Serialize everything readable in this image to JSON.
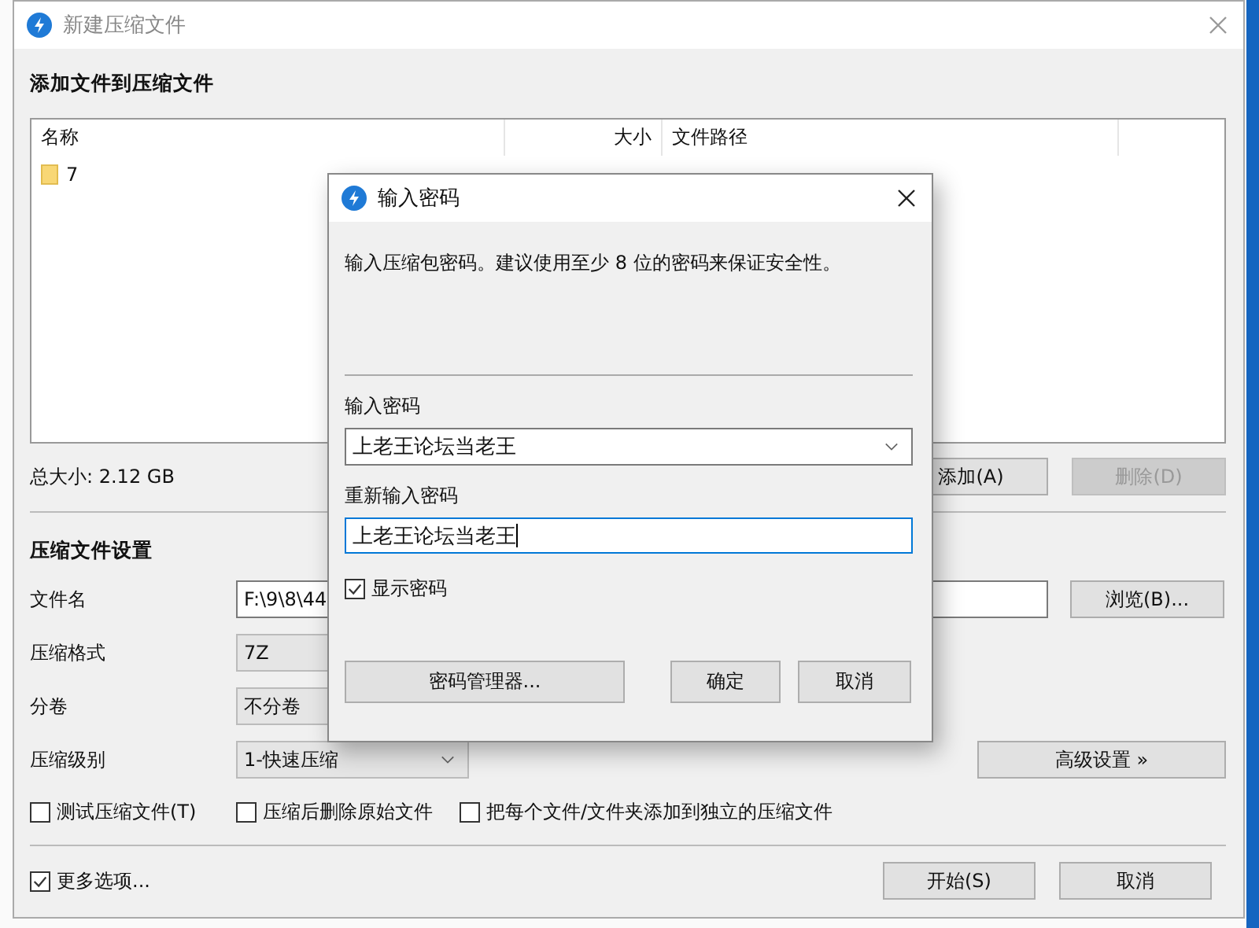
{
  "main_window": {
    "title": "新建压缩文件",
    "section_title": "添加文件到压缩文件",
    "file_list": {
      "columns": [
        "名称",
        "大小",
        "文件路径"
      ],
      "rows": [
        {
          "name": "7"
        }
      ]
    },
    "total_size": "总大小: 2.12 GB",
    "list_buttons": [
      {
        "label": "添加(A)",
        "disabled": false
      },
      {
        "label": "删除(D)",
        "disabled": true
      }
    ],
    "settings_title": "压缩文件设置",
    "settings": [
      {
        "kind": "text",
        "label": "文件名",
        "value": "F:\\9\\8\\44"
      },
      {
        "kind": "select",
        "label": "压缩格式",
        "value": "7Z"
      },
      {
        "kind": "select",
        "label": "分卷",
        "value": "不分卷"
      },
      {
        "kind": "select",
        "label": "压缩级别",
        "value": "1-快速压缩"
      }
    ],
    "browse_button": "浏览(B)...",
    "advanced_button": "高级设置 »",
    "options": [
      {
        "label": "测试压缩文件(T)",
        "checked": false
      },
      {
        "label": "压缩后删除原始文件",
        "checked": false
      },
      {
        "label": "把每个文件/文件夹添加到独立的压缩文件",
        "checked": false
      }
    ],
    "more_options": {
      "label": "更多选项...",
      "checked": true
    },
    "footer_buttons": [
      "开始(S)",
      "取消"
    ]
  },
  "dialog": {
    "title": "输入密码",
    "description": "输入压缩包密码。建议使用至少 8 位的密码来保证安全性。",
    "password_label": "输入密码",
    "password_value": "上老王论坛当老王",
    "confirm_label": "重新输入密码",
    "confirm_value": "上老王论坛当老王",
    "show_password": {
      "label": "显示密码",
      "checked": true
    },
    "buttons": [
      "密码管理器...",
      "确定",
      "取消"
    ]
  }
}
